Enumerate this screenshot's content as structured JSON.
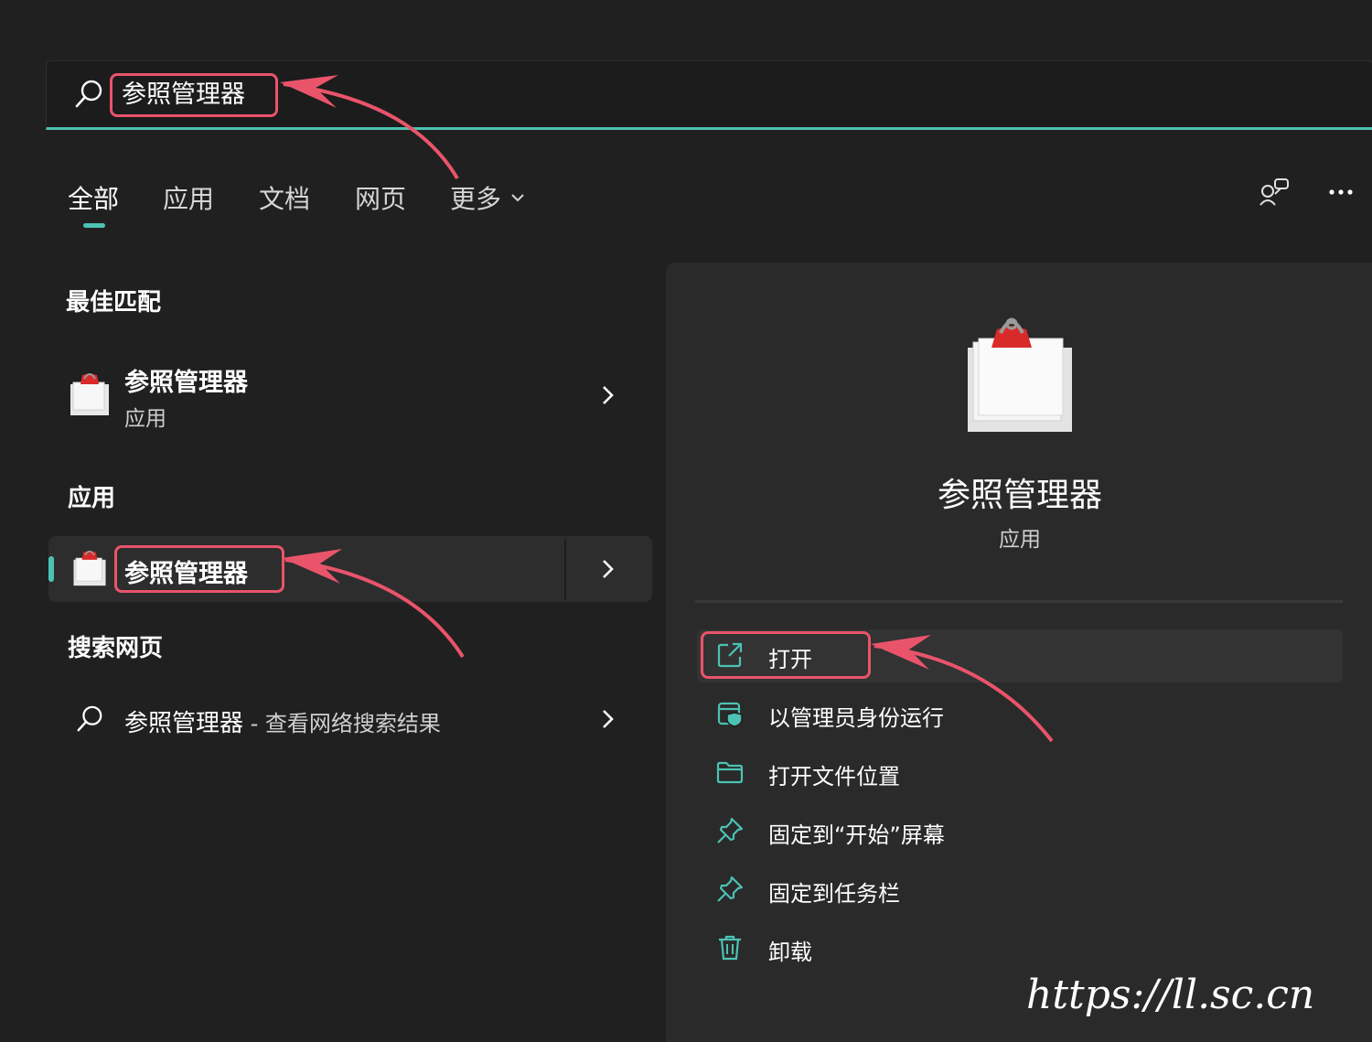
{
  "search": {
    "query": "参照管理器"
  },
  "tabs": [
    {
      "label": "全部"
    },
    {
      "label": "应用"
    },
    {
      "label": "文档"
    },
    {
      "label": "网页"
    },
    {
      "label": "更多"
    }
  ],
  "best_match": {
    "heading": "最佳匹配",
    "title": "参照管理器",
    "subtitle": "应用"
  },
  "apps": {
    "heading": "应用",
    "item_title": "参照管理器"
  },
  "web": {
    "heading": "搜索网页",
    "query": "参照管理器",
    "suffix": " - 查看网络搜索结果"
  },
  "details": {
    "title": "参照管理器",
    "subtitle": "应用",
    "actions": [
      {
        "label": "打开",
        "icon": "open-external-icon"
      },
      {
        "label": "以管理员身份运行",
        "icon": "shield-admin-icon"
      },
      {
        "label": "打开文件位置",
        "icon": "folder-icon"
      },
      {
        "label": "固定到“开始”屏幕",
        "icon": "pin-icon"
      },
      {
        "label": "固定到任务栏",
        "icon": "pin-icon"
      },
      {
        "label": "卸载",
        "icon": "trash-icon"
      }
    ]
  },
  "watermark": "https://ll.sc.cn",
  "colors": {
    "accent": "#4cc2b4",
    "annotation": "#e9546b",
    "background": "#202020",
    "panel": "#2a2a2a"
  }
}
